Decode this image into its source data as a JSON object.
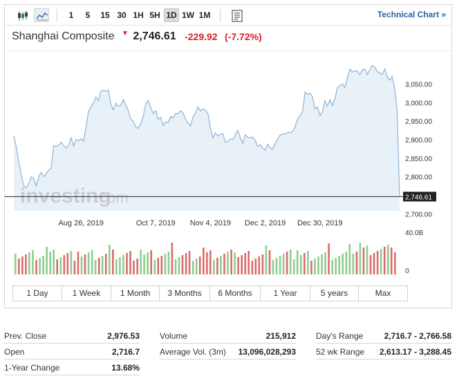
{
  "toolbar": {
    "chart_type_icons": [
      "candlestick-icon",
      "area-chart-icon"
    ],
    "intervals": [
      "1",
      "5",
      "15",
      "30",
      "1H",
      "5H",
      "1D",
      "1W",
      "1M"
    ],
    "active_interval": "1D",
    "technical_chart_label": "Technical Chart »"
  },
  "instrument": {
    "name": "Shanghai Composite",
    "direction_glyph": "▼",
    "last": "2,746.61",
    "change": "-229.92",
    "change_pct": "(-7.72%)"
  },
  "watermark": {
    "brand": "investing",
    "suffix": ".com"
  },
  "chart_data": {
    "type": "area",
    "title": "",
    "xlabel": "",
    "ylabel": "",
    "x_tick_labels": [
      "Aug 26, 2019",
      "Oct 7, 2019",
      "Nov 4, 2019",
      "Dec 2, 2019",
      "Dec 30, 2019"
    ],
    "y_tick_labels": [
      "3,050.00",
      "3,000.00",
      "2,950.00",
      "2,900.00",
      "2,850.00",
      "2,800.00",
      "2,700.00"
    ],
    "ylim": [
      2700,
      3080
    ],
    "last_value_label": "2,746.61",
    "last_value": 2746.61,
    "grid": false,
    "values": [
      2910,
      2880,
      2840,
      2805,
      2776,
      2770,
      2782,
      2800,
      2795,
      2776,
      2800,
      2812,
      2800,
      2808,
      2818,
      2823,
      2884,
      2882,
      2885,
      2893,
      2885,
      2877,
      2885,
      2905,
      2883,
      2900,
      2897,
      2903,
      2896,
      2935,
      2975,
      2988,
      3000,
      3015,
      3005,
      3030,
      3033,
      3030,
      3033,
      2995,
      2980,
      2998,
      2990,
      2993,
      3008,
      2993,
      2978,
      2955,
      2950,
      2935,
      2930,
      2943,
      2963,
      2996,
      3005,
      2986,
      2970,
      2978,
      2955,
      2960,
      2938,
      2948,
      2946,
      2963,
      2958,
      2970,
      2970,
      2978,
      2972,
      2955,
      2945,
      2937,
      2962,
      2972,
      2988,
      2977,
      2983,
      2979,
      2970,
      2930,
      2905,
      2918,
      2910,
      2915,
      2916,
      2893,
      2895,
      2902,
      2900,
      2914,
      2925,
      2905,
      2890,
      2913,
      2906,
      2905,
      2907,
      2898,
      2882,
      2887,
      2877,
      2872,
      2888,
      2878,
      2874,
      2890,
      2902,
      2912,
      2915,
      2915,
      2920,
      2919,
      2922,
      2935,
      2955,
      2965,
      2975,
      3028,
      3022,
      3025,
      3015,
      2983,
      2988,
      2965,
      2975,
      3005,
      2990,
      3008,
      2992,
      3010,
      3040,
      3045,
      3050,
      3040,
      3065,
      3090,
      3082,
      3085,
      3085,
      3075,
      3087,
      3090,
      3075,
      3088,
      3100,
      3095,
      3083,
      3080,
      3075,
      3090,
      3070,
      3060,
      3070,
      3040,
      2976,
      2746
    ],
    "volume_axis_labels": [
      "40.0B",
      "0"
    ],
    "volume_up_color": "#8fcc8f",
    "volume_down_color": "#d86b6b",
    "line_color": "#8eb2d4",
    "fill_color": "#e9f1f8"
  },
  "range_buttons": [
    "1 Day",
    "1 Week",
    "1 Month",
    "3 Months",
    "6 Months",
    "1 Year",
    "5 years",
    "Max"
  ],
  "stats": {
    "col1": [
      {
        "label": "Prev. Close",
        "value": "2,976.53"
      },
      {
        "label": "Open",
        "value": "2,716.7"
      },
      {
        "label": "1-Year Change",
        "value": "13.68%"
      }
    ],
    "col2": [
      {
        "label": "Volume",
        "value": "215,912"
      },
      {
        "label": "Average Vol. (3m)",
        "value": "13,096,028,293"
      }
    ],
    "col3": [
      {
        "label": "Day's Range",
        "value": "2,716.7 - 2,766.58"
      },
      {
        "label": "52 wk Range",
        "value": "2,613.17 - 3,288.45"
      }
    ]
  }
}
